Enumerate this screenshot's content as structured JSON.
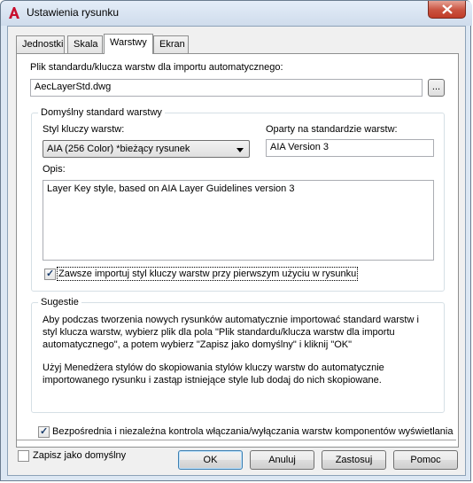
{
  "window": {
    "title": "Ustawienia rysunku"
  },
  "tabs": [
    {
      "label": "Jednostki"
    },
    {
      "label": "Skala"
    },
    {
      "label": "Warstwy"
    },
    {
      "label": "Ekran"
    }
  ],
  "active_tab": "Warstwy",
  "import_file": {
    "label": "Plik standardu/klucza warstw dla importu automatycznego:",
    "value": "AecLayerStd.dwg",
    "browse_label": "..."
  },
  "default_standard": {
    "group_title": "Domyślny standard warstwy",
    "key_style_label": "Styl kluczy warstw:",
    "key_style_value": "AIA (256 Color) *bieżący rysunek",
    "based_on_label": "Oparty na standardzie warstw:",
    "based_on_value": "AIA Version 3",
    "description_label": "Opis:",
    "description_value": "Layer Key style, based on AIA Layer Guidelines version 3",
    "always_import_label": "Zawsze importuj styl kluczy warstw przy pierwszym użyciu w rysunku",
    "always_import_checked": true
  },
  "tips": {
    "group_title": "Sugestie",
    "paragraph1": "Aby podczas tworzenia nowych rysunków automatycznie importować standard warstw i styl klucza warstw, wybierz plik dla pola \"Plik standardu/klucza warstw dla importu automatycznego\", a potem wybierz \"Zapisz jako domyślny\" i kliknij \"OK\"",
    "paragraph2": "Użyj Menedżera stylów do skopiowania stylów kluczy warstw do automatycznie importowanego rysunku i zastąp istniejące style lub dodaj do nich skopiowane."
  },
  "direct_control": {
    "label": "Bezpośrednia i niezależna kontrola włączania/wyłączania warstw komponentów wyświetlania",
    "checked": true
  },
  "footer": {
    "save_default_label": "Zapisz jako domyślny",
    "save_default_checked": false,
    "ok_label": "OK",
    "cancel_label": "Anuluj",
    "apply_label": "Zastosuj",
    "help_label": "Pomoc"
  },
  "colors": {
    "accent_default_button": "#3c7fb1",
    "close_button": "#c9523f",
    "app_icon": "#c8102e"
  },
  "icons": [
    "autocad-app-icon",
    "close-icon",
    "checkmark-icon",
    "dropdown-arrow-icon"
  ]
}
